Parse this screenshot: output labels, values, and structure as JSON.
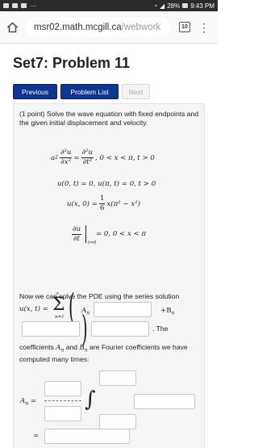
{
  "status": {
    "battery": "28%",
    "time": "9:43 PM"
  },
  "browser": {
    "url_domain": "msr02.math.mcgill.ca",
    "url_path": "/webwork",
    "tab_count": "10"
  },
  "page": {
    "title": "Set7: Problem 11"
  },
  "nav": {
    "previous": "Previous",
    "problem_list": "Problem List",
    "next": "Next"
  },
  "problem": {
    "intro": "(1 point) Solve the wave equation with fixed endpoints and the given initial displacement and velocity.",
    "eq1_a2": "a",
    "eq1_exp": "2",
    "eq1_num_left": "∂²u",
    "eq1_den_left": "∂x²",
    "eq1_num_right": "∂²u",
    "eq1_den_right": "∂t²",
    "eq1_domain": ", 0 < x < π, t > 0",
    "eq2": "u(0, t) = 0, u(π, t) = 0, t > 0",
    "eq3_left": "u(x, 0) =",
    "eq3_frac_num": "1",
    "eq3_frac_den": "6",
    "eq3_right": "x(π² − x²)",
    "eq4_num": "∂u",
    "eq4_den": "∂t",
    "eq4_eval": "t=0",
    "eq4_right": "= 0, 0 < x < π",
    "series_text": "Now we can solve the PDE using the series solution",
    "series_lhs": "u(x, t) =",
    "series_sum_top": "∞",
    "series_sum_bottom": "n=1",
    "series_An": "A",
    "series_An_sub": "n",
    "series_plus_Bn": "+B",
    "series_Bn_sub": "n",
    "series_the": ". The",
    "coeff_text_1": "coefficients",
    "coeff_An": "A",
    "coeff_and": "and",
    "coeff_Bn": "B",
    "coeff_text_2": "are Fourier coefficients we have computed many times:",
    "an_lhs": "A",
    "an_sub": "n",
    "an_eq": "=",
    "eq_sign": "="
  }
}
